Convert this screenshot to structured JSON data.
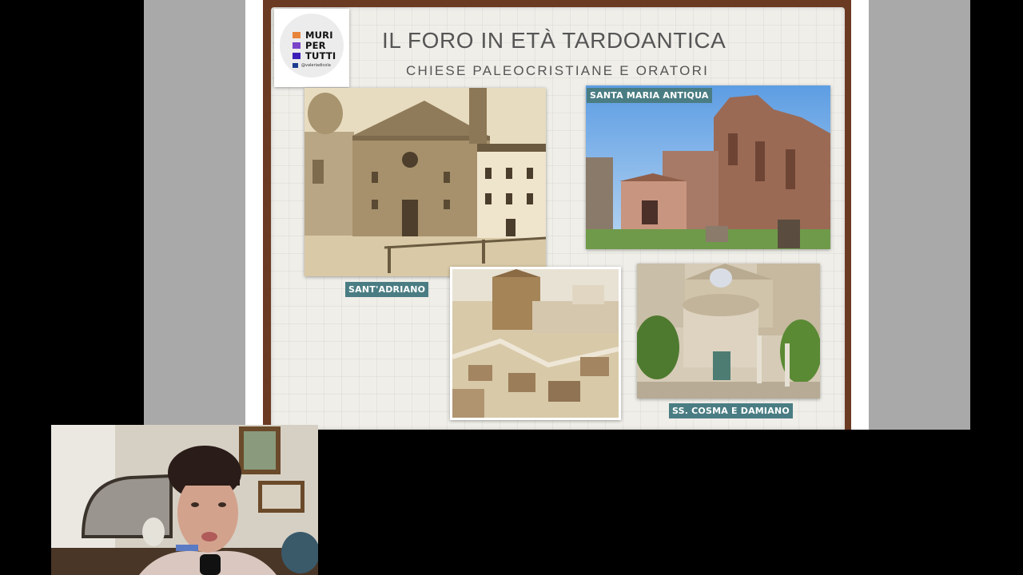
{
  "slide": {
    "title": "IL FORO IN ETÀ TARDOANTICA",
    "subtitle": "CHIESE PALEOCRISTIANE E ORATORI"
  },
  "logo": {
    "lines": [
      "MURI",
      "PER",
      "TUTTI"
    ],
    "handle": "@valeriadicola",
    "colors": [
      "#e8843a",
      "#7a45c9",
      "#3b1fb8",
      "#1c3d8f"
    ]
  },
  "photos": [
    {
      "name": "sant-adriano-photo",
      "caption": "SANT'ADRIANO"
    },
    {
      "name": "santa-maria-antiqua-photo",
      "caption": "SANTA MARIA ANTIQUA"
    },
    {
      "name": "forum-reconstruction-photo",
      "caption": ""
    },
    {
      "name": "cosma-damiano-photo",
      "caption": "SS. COSMA E DAMIANO"
    }
  ],
  "webcam": {
    "label": "presenter-webcam"
  }
}
